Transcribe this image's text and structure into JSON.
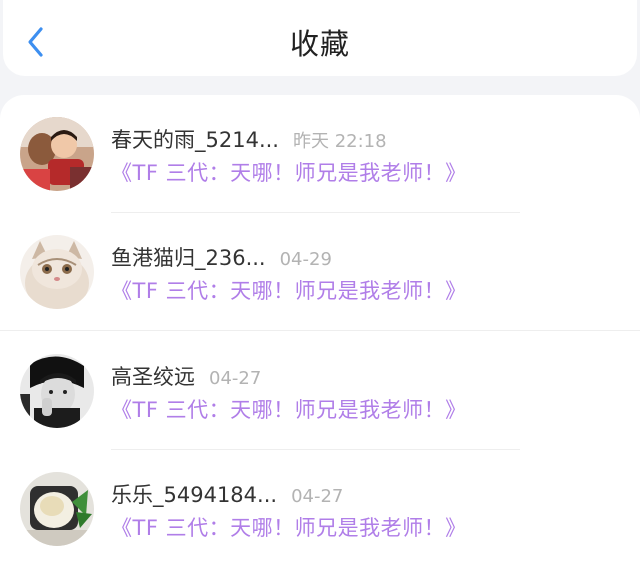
{
  "header": {
    "title": "收藏",
    "back_icon": "chevron-left-icon",
    "accent_color": "#3d8ff0"
  },
  "favorites": [
    {
      "username": "春天的雨_5214...",
      "time": "昨天 22:18",
      "post_title": "《TF 三代：天哪！师兄是我老师！》"
    },
    {
      "username": "鱼港猫归_236...",
      "time": "04-29",
      "post_title": "《TF 三代：天哪！师兄是我老师！》"
    },
    {
      "username": "高圣绞远",
      "time": "04-27",
      "post_title": "《TF 三代：天哪！师兄是我老师！》"
    },
    {
      "username": "乐乐_5494184...",
      "time": "04-27",
      "post_title": "《TF 三代：天哪！师兄是我老师！》"
    }
  ],
  "colors": {
    "title_purple": "#b07ee8",
    "time_gray": "#b3b3b3",
    "background": "#f3f4f7"
  }
}
